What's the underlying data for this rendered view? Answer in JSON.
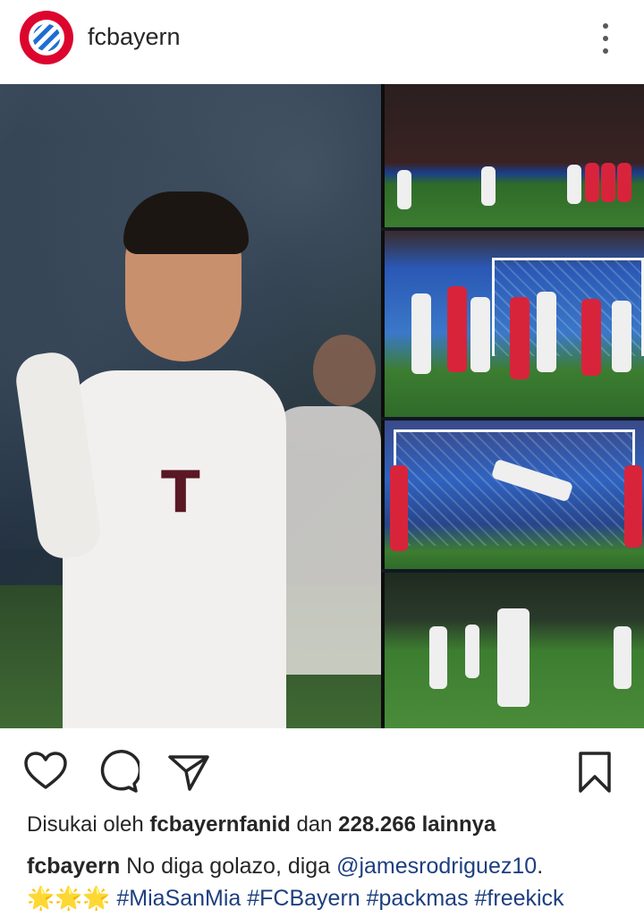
{
  "header": {
    "username": "fcbayern",
    "avatar_icon": "fc-bayern-logo-icon",
    "more_icon": "more-vertical-icon"
  },
  "photo": {
    "main_jersey_text": "T",
    "thumbnails": 4
  },
  "actions": {
    "like_icon": "heart-icon",
    "comment_icon": "comment-bubble-icon",
    "share_icon": "send-arrow-icon",
    "save_icon": "bookmark-icon"
  },
  "likes": {
    "prefix": "Disukai oleh",
    "user": "fcbayernfanid",
    "joiner": "dan",
    "count_text": "228.266 lainnya"
  },
  "caption": {
    "user": "fcbayern",
    "text": "No diga golazo, diga",
    "mention": "@jamesrodriguez10",
    "end": ".",
    "emoji": "🌟🌟🌟",
    "hashtags": "#MiaSanMia #FCBayern #packmas #freekick"
  },
  "colors": {
    "bayern_red": "#dc052d",
    "link_blue": "#1d3f80",
    "text": "#262626"
  }
}
